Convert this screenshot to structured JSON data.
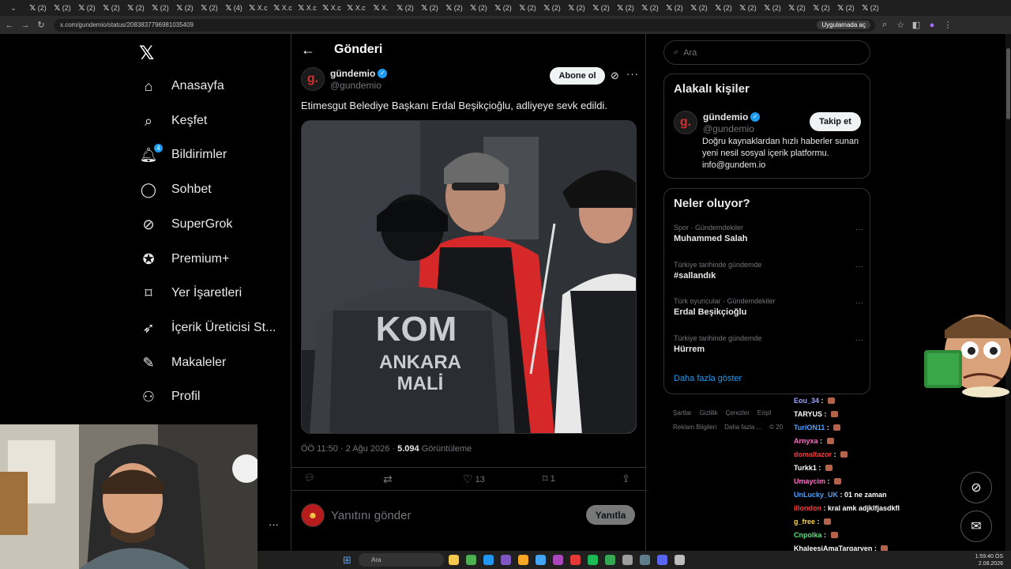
{
  "browser": {
    "tabs": [
      "(2)",
      "(2)",
      "(2)",
      "(2)",
      "(2)",
      "(2)",
      "(2)",
      "(2)",
      "(4)",
      "X.c",
      "X.c",
      "X.c",
      "X.c",
      "X.c",
      "X.",
      "(2)",
      "(2)",
      "(2)",
      "(2)",
      "(2)",
      "(2)",
      "(2)",
      "(2)",
      "(2)",
      "(2)",
      "(2)",
      "(2)",
      "(2)",
      "(2)",
      "(2)",
      "(2)",
      "(2)",
      "(2)",
      "(2)",
      "(2)"
    ],
    "url": "x.com/gundemio/status/2083837796981035409",
    "app_button": "Uygulamada aç"
  },
  "sidebar": {
    "items": [
      {
        "label": "Anasayfa",
        "icon": "home-icon"
      },
      {
        "label": "Keşfet",
        "icon": "search-icon"
      },
      {
        "label": "Bildirimler",
        "icon": "bell-icon",
        "badge": "4"
      },
      {
        "label": "Sohbet",
        "icon": "chat-icon"
      },
      {
        "label": "SuperGrok",
        "icon": "grok-icon"
      },
      {
        "label": "Premium+",
        "icon": "premium-icon"
      },
      {
        "label": "Yer İşaretleri",
        "icon": "bookmark-icon"
      },
      {
        "label": "İçerik Üreticisi St...",
        "icon": "rocket-icon"
      },
      {
        "label": "Makaleler",
        "icon": "article-icon"
      },
      {
        "label": "Profil",
        "icon": "profile-icon"
      }
    ]
  },
  "post": {
    "header_title": "Gönderi",
    "author_name": "gündemio",
    "author_handle": "@gundemio",
    "subscribe_label": "Abone ol",
    "text": "Etimesgut Belediye Başkanı Erdal Beşikçioğlu, adliyeye sevk edildi.",
    "photo_text": {
      "line1": "KOM",
      "line2": "ANKARA",
      "line3": "MALİ"
    },
    "time": "ÖÖ 11:50 · 2 Ağu 2026 · ",
    "views_count": "5.094",
    "views_label": " Görüntüleme",
    "likes": "13",
    "bookmarks": "1",
    "reply_placeholder": "Yanıtını gönder",
    "reply_button": "Yanıtla"
  },
  "right": {
    "search_placeholder": "Ara",
    "related_title": "Alakalı kişiler",
    "related": {
      "name": "gündemio",
      "handle": "@gundemio",
      "follow_label": "Takip et",
      "bio": "Doğru kaynaklardan hızlı haberler sunan yeni nesil sosyal içerik platformu. info@gundem.io"
    },
    "trends_title": "Neler oluyor?",
    "trends": [
      {
        "category": "Spor · Gündemdekiler",
        "title": "Muhammed Salah"
      },
      {
        "category": "Türkiye tarihinde gündemde",
        "title": "#sallandık"
      },
      {
        "category": "Türk oyuncular · Gündemdekiler",
        "title": "Erdal Beşikçioğlu"
      },
      {
        "category": "Türkiye tarihinde gündemde",
        "title": "Hürrem"
      }
    ],
    "show_more": "Daha fazla göster",
    "footer": [
      "Şartlar",
      "Gizlilik",
      "Çerezler",
      "Erişil",
      "Reklam Bilgileri",
      "Daha fazla ...",
      "© 20"
    ]
  },
  "chat": [
    {
      "user": "Eou_34",
      "msg": "",
      "color": "#9aa7ff"
    },
    {
      "user": "TARYUS",
      "msg": "",
      "color": "#ffffff"
    },
    {
      "user": "TuriON11",
      "msg": "",
      "color": "#4aa3ff"
    },
    {
      "user": "Arnyxa",
      "msg": "",
      "color": "#ff6ec7"
    },
    {
      "user": "domaltazor",
      "msg": "",
      "color": "#ff3b3b"
    },
    {
      "user": "Turkk1",
      "msg": "",
      "color": "#ffffff"
    },
    {
      "user": "Umaycim",
      "msg": "",
      "color": "#ff6ec7"
    },
    {
      "user": "UnLucky_UK",
      "msg": "01 ne zaman",
      "color": "#4aa3ff"
    },
    {
      "user": "illondon",
      "msg": "kral amk adjklfjasdkfl",
      "color": "#ff3b3b"
    },
    {
      "user": "g_free",
      "msg": "",
      "color": "#ffd54a"
    },
    {
      "user": "Cnpolka",
      "msg": "",
      "color": "#59e37a"
    },
    {
      "user": "KhaleesiAmaTargaryen",
      "msg": "",
      "color": "#ffffff"
    }
  ],
  "taskbar": {
    "search": "Ara",
    "time": "1:59:40 ÖS",
    "date": "2.08.2026"
  }
}
